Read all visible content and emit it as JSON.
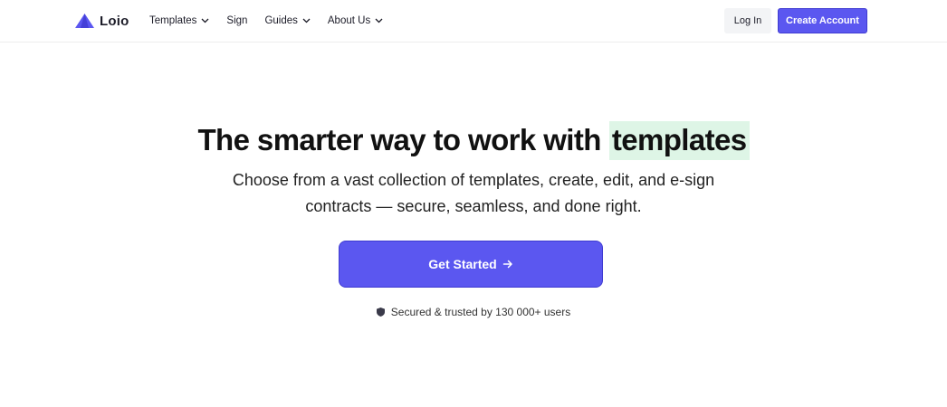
{
  "brand": {
    "name": "Loio",
    "color": "#5b57f0",
    "icon": "loio-mountain-logo-icon"
  },
  "nav": {
    "items": [
      {
        "label": "Templates",
        "icon": "chevron-down-icon"
      },
      {
        "label": "Sign"
      },
      {
        "label": "Guides",
        "icon": "chevron-down-icon"
      },
      {
        "label": "About Us",
        "icon": "chevron-down-icon"
      }
    ],
    "login_label": "Log In",
    "create_account_label": "Create Account"
  },
  "hero": {
    "title_main": "The smarter way to work with",
    "title_highlight": "templates",
    "highlight_color": "#def5e6",
    "subtitle_line1": "Choose from a vast collection of templates, create, edit, and e-sign",
    "subtitle_line2": "contracts — secure, seamless, and done right.",
    "cta_label": "Get Started",
    "cta_icon": "arrow-right-icon",
    "trust_icon": "shield-icon",
    "trust_text": "Secured & trusted by 130 000+ users"
  }
}
